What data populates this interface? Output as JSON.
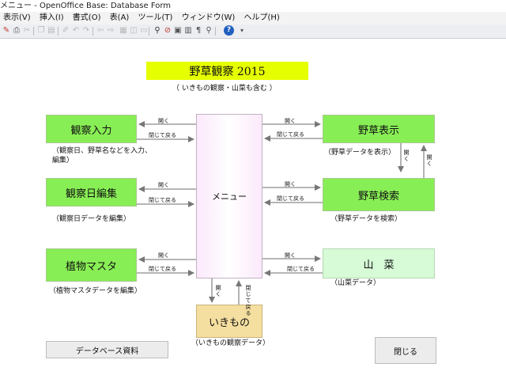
{
  "window": {
    "title": "メニュー - OpenOffice Base: Database Form"
  },
  "menubar": [
    "表示(V)",
    "挿入(I)",
    "書式(O)",
    "表(A)",
    "ツール(T)",
    "ウィンドウ(W)",
    "ヘルプ(H)"
  ],
  "toolbar_icons": [
    "edit-file-icon",
    "print-icon",
    "cut-icon",
    "copy-icon",
    "paste-icon",
    "format-paint-icon",
    "undo-icon",
    "redo-icon",
    "table-icon",
    "navigator-icon",
    "find-icon",
    "no-entry-icon",
    "gallery-icon",
    "datasource-icon",
    "gallery-icon",
    "zoom-icon",
    "help-icon"
  ],
  "form": {
    "title": "野草観察 2015",
    "subtitle": "（ いきもの観察・山菜も含む ）",
    "menu_center": "メニュー",
    "boxes": {
      "kansatsu_input": "観察入力",
      "kansatsubi_edit": "観察日編集",
      "shokubutsu_master": "植物マスタ",
      "yasou_display": "野草表示",
      "yasou_search": "野草検索",
      "sansai": "山　菜",
      "ikimono": "いきもの"
    },
    "descriptions": {
      "kansatsu_input_1": "（観察日、野草名などを入力、",
      "kansatsu_input_2": "編集）",
      "kansatsubi_edit": "（観察日データを編集）",
      "shokubutsu_master": "（植物マスタデータを編集）",
      "yasou_display": "（野草データを表示）",
      "yasou_search": "（野草データを検索）",
      "sansai": "（山菜データ）",
      "ikimono": "（いきもの観察データ）"
    },
    "arrow_labels": {
      "open": "開く",
      "close_return": "閉じて戻る",
      "open_vertical": "開く",
      "close_return_vertical": "閉じて戻る"
    },
    "buttons": {
      "database_docs": "データベース資料",
      "close": "閉じる"
    }
  }
}
